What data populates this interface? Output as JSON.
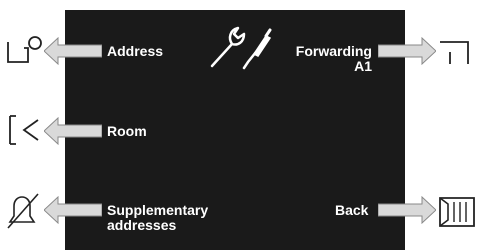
{
  "screen": {
    "background": "#1a1a1a",
    "title_icon": "wrench-screwdriver-icon"
  },
  "softkeys": {
    "left": [
      {
        "label": "Address",
        "icon": "key-lock-icon"
      },
      {
        "label": "Room",
        "icon": "room-door-icon"
      },
      {
        "label": "Supplementary",
        "label2": "addresses",
        "icon": "bell-mute-icon"
      }
    ],
    "right": [
      {
        "label": "Forwarding",
        "label2": "A1",
        "icon": "forward-door-icon"
      },
      {
        "label": "Back",
        "icon": "back-door-icon"
      }
    ]
  }
}
